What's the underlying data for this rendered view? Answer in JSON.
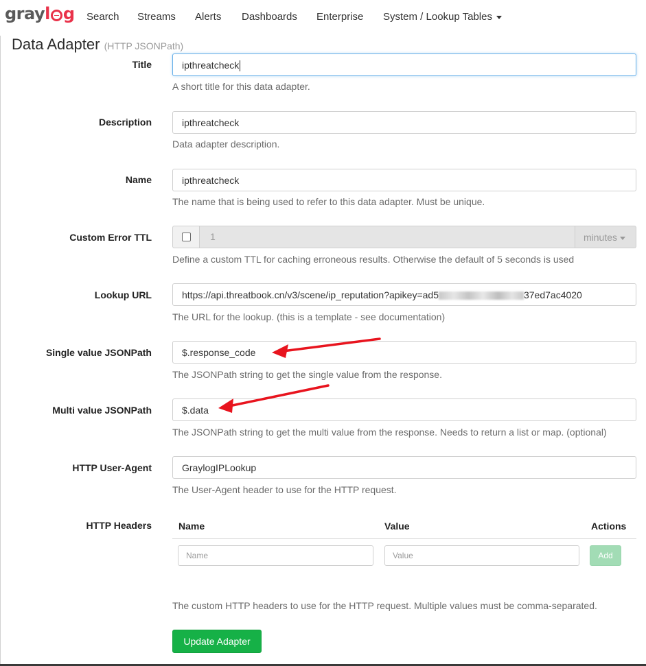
{
  "navbar": {
    "brand_prefix": "gray",
    "brand_suffix": "g",
    "items": [
      "Search",
      "Streams",
      "Alerts",
      "Dashboards",
      "Enterprise",
      "System / Lookup Tables"
    ]
  },
  "page": {
    "title": "Data Adapter",
    "subtitle": "(HTTP JSONPath)"
  },
  "form": {
    "title": {
      "label": "Title",
      "value": "ipthreatcheck",
      "help": "A short title for this data adapter."
    },
    "description": {
      "label": "Description",
      "value": "ipthreatcheck",
      "help": "Data adapter description."
    },
    "name": {
      "label": "Name",
      "value": "ipthreatcheck",
      "help": "The name that is being used to refer to this data adapter. Must be unique."
    },
    "custom_error_ttl": {
      "label": "Custom Error TTL",
      "checked": false,
      "value": "1",
      "unit": "minutes",
      "help": "Define a custom TTL for caching erroneous results. Otherwise the default of 5 seconds is used"
    },
    "lookup_url": {
      "label": "Lookup URL",
      "value_start": "https://api.threatbook.cn/v3/scene/ip_reputation?apikey=ad5",
      "value_end": "37ed7ac4020",
      "help": "The URL for the lookup. (this is a template - see documentation)"
    },
    "single_value_jsonpath": {
      "label": "Single value JSONPath",
      "value": "$.response_code",
      "help": "The JSONPath string to get the single value from the response."
    },
    "multi_value_jsonpath": {
      "label": "Multi value JSONPath",
      "value": "$.data",
      "help": "The JSONPath string to get the multi value from the response. Needs to return a list or map. (optional)"
    },
    "user_agent": {
      "label": "HTTP User-Agent",
      "value": "GraylogIPLookup",
      "help": "The User-Agent header to use for the HTTP request."
    },
    "http_headers": {
      "label": "HTTP Headers",
      "columns": [
        "Name",
        "Value",
        "Actions"
      ],
      "name_placeholder": "Name",
      "value_placeholder": "Value",
      "add_label": "Add",
      "help": "The custom HTTP headers to use for the HTTP request. Multiple values must be comma-separated."
    },
    "submit_label": "Update Adapter"
  },
  "colors": {
    "brand_red": "#e9324a",
    "primary_green": "#16b147",
    "annotation_red": "#e8141e"
  }
}
